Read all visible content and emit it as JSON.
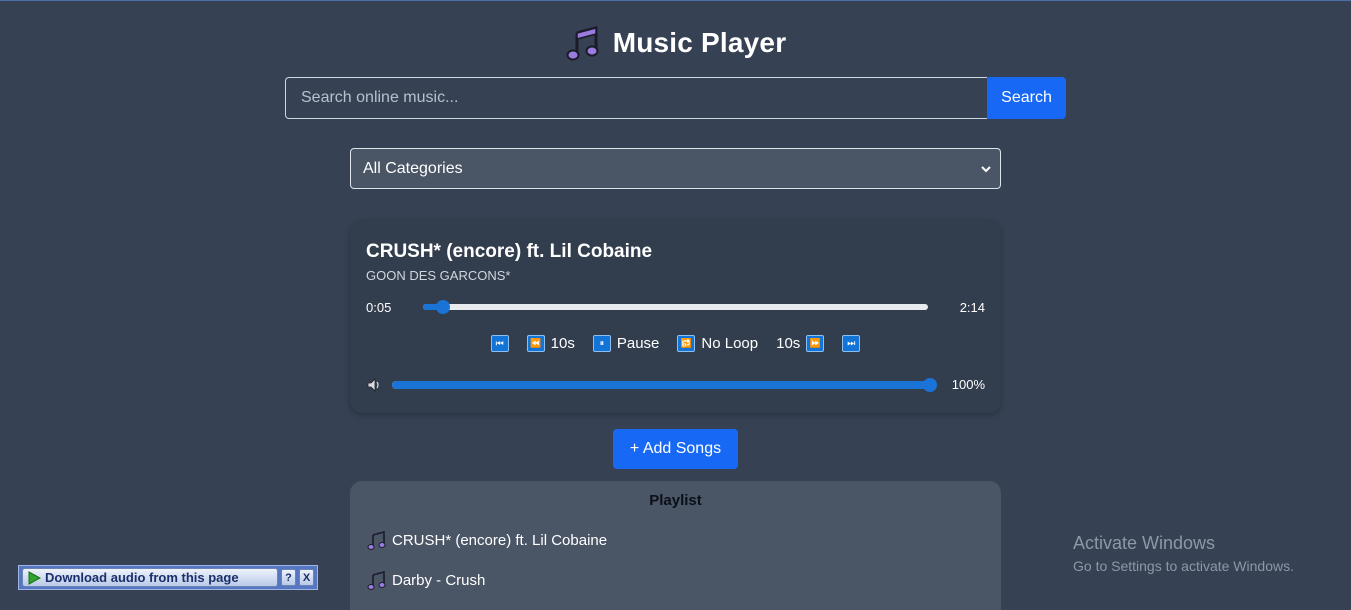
{
  "header": {
    "title": "Music Player",
    "icon": "music-note-icon"
  },
  "search": {
    "placeholder": "Search online music...",
    "value": "",
    "button_label": "Search"
  },
  "category": {
    "selected": "All Categories"
  },
  "player": {
    "track_title": "CRUSH* (encore) ft. Lil Cobaine",
    "artist": "GOON DES GARCONS*",
    "current_time": "0:05",
    "total_time": "2:14",
    "progress_fraction": 0.04,
    "controls": {
      "prev_icon": "skip-previous-icon",
      "rewind_label": "10s",
      "pause_label": "Pause",
      "loop_label": "No Loop",
      "forward_label": "10s",
      "next_icon": "skip-next-icon"
    },
    "volume_fraction": 1.0,
    "volume_label": "100%"
  },
  "add_songs": {
    "label": "+ Add Songs"
  },
  "playlist": {
    "heading": "Playlist",
    "items": [
      {
        "label": "CRUSH* (encore) ft. Lil Cobaine"
      },
      {
        "label": "Darby - Crush"
      }
    ]
  },
  "download_bar": {
    "label": "Download audio from this page",
    "help": "?",
    "close": "X"
  },
  "watermark": {
    "line1": "Activate Windows",
    "line2": "Go to Settings to activate Windows."
  },
  "colors": {
    "background": "#364153",
    "accent": "#1769f5",
    "card": "#323d4d",
    "playlist_bg": "#4a5566"
  }
}
